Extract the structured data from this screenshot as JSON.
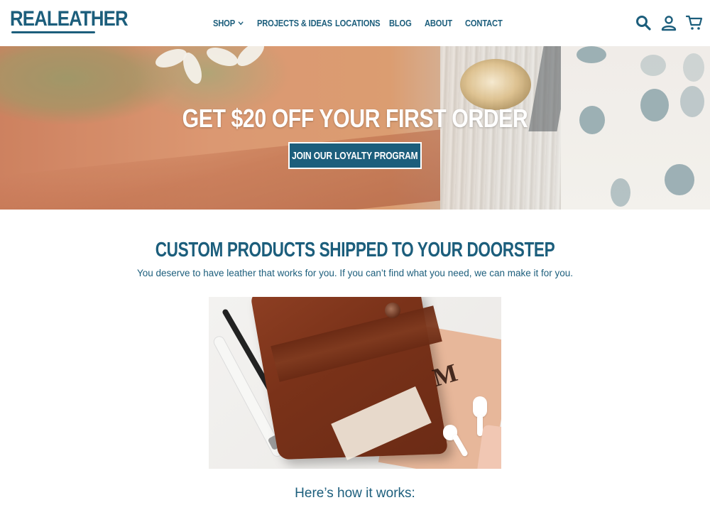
{
  "brand": {
    "logo_text": "REALEATHER",
    "primary_color": "#1c5e7c"
  },
  "nav": {
    "items": [
      {
        "label": "SHOP",
        "has_dropdown": true
      },
      {
        "label": "PROJECTS & IDEAS"
      },
      {
        "label": "LOCATIONS"
      },
      {
        "label": "BLOG"
      },
      {
        "label": "ABOUT"
      },
      {
        "label": "CONTACT"
      }
    ],
    "icons": [
      "search-icon",
      "account-icon",
      "cart-icon"
    ]
  },
  "hero": {
    "title": "GET $20 OFF YOUR FIRST ORDER",
    "button_label": "JOIN OUR LOYALTY PROGRAM"
  },
  "section": {
    "title": "CUSTOM PRODUCTS SHIPPED TO YOUR DOORSTEP",
    "subtitle": "You deserve to have leather that works for you. If you can’t find what you need, we can make it for you.",
    "image_monogram": "M",
    "how_title": "Here’s how it works:"
  }
}
